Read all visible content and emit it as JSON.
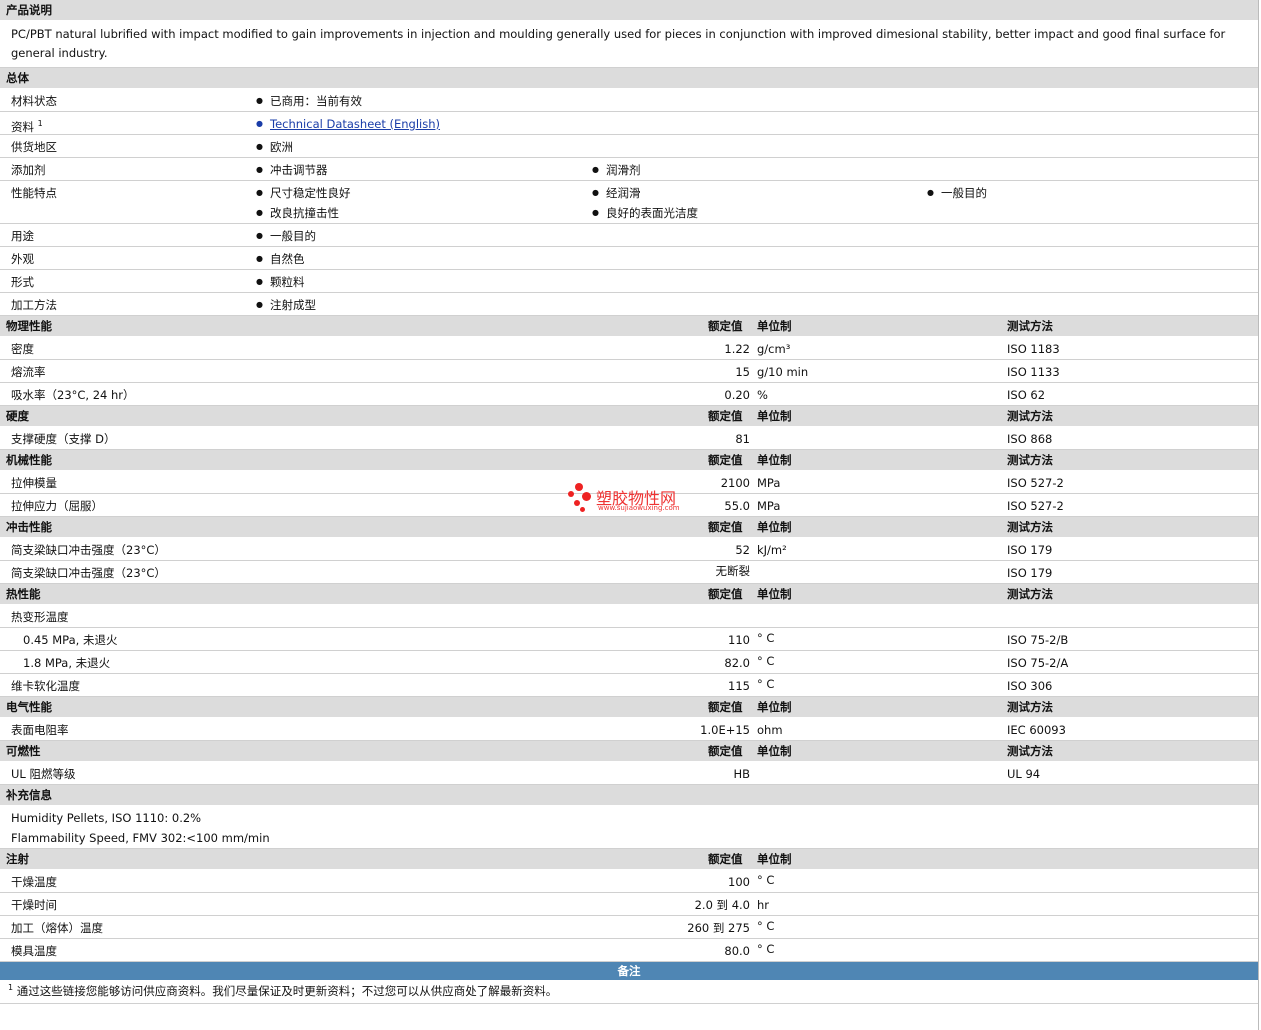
{
  "description": {
    "header": "产品说明",
    "text": "PC/PBT natural lubrified with impact modified to gain improvements in injection and moulding generally used for pieces in conjunction with improved dimesional stability, better impact and good final surface for general industry."
  },
  "general": {
    "header": "总体",
    "status_label": "材料状态",
    "status_value": "已商用：当前有效",
    "docs_label": "资料",
    "docs_sup": "1",
    "docs_link": "Technical Datasheet (English)",
    "region_label": "供货地区",
    "region_value": "欧洲",
    "additives_label": "添加剂",
    "additives": [
      "冲击调节器",
      "润滑剂"
    ],
    "features_label": "性能特点",
    "features": [
      "尺寸稳定性良好",
      "经润滑",
      "一般目的",
      "改良抗撞击性",
      "良好的表面光洁度"
    ],
    "uses_label": "用途",
    "uses_value": "一般目的",
    "appearance_label": "外观",
    "appearance_value": "自然色",
    "form_label": "形式",
    "form_value": "颗粒料",
    "method_label": "加工方法",
    "method_value": "注射成型"
  },
  "cols": {
    "nominal": "额定值",
    "unit": "单位制",
    "test": "测试方法"
  },
  "physical": {
    "header": "物理性能",
    "rows": [
      {
        "label": "密度",
        "value": "1.22",
        "unit": "g/cm³",
        "test": "ISO 1183"
      },
      {
        "label": "熔流率",
        "value": "15",
        "unit": "g/10 min",
        "test": "ISO 1133"
      },
      {
        "label": "吸水率（23°C, 24 hr）",
        "value": "0.20",
        "unit": "%",
        "test": "ISO 62"
      }
    ]
  },
  "hardness": {
    "header": "硬度",
    "rows": [
      {
        "label": "支撑硬度（支撑 D）",
        "value": "81",
        "unit": "",
        "test": "ISO 868"
      }
    ]
  },
  "mechanical": {
    "header": "机械性能",
    "rows": [
      {
        "label": "拉伸模量",
        "value": "2100",
        "unit": "MPa",
        "test": "ISO 527-2"
      },
      {
        "label": "拉伸应力（屈服）",
        "value": "55.0",
        "unit": "MPa",
        "test": "ISO 527-2"
      }
    ]
  },
  "impact": {
    "header": "冲击性能",
    "rows": [
      {
        "label": "简支梁缺口冲击强度（23°C）",
        "value": "52",
        "unit": "kJ/m²",
        "test": "ISO 179"
      },
      {
        "label": "简支梁缺口冲击强度（23°C）",
        "value": "无断裂",
        "unit": "",
        "test": "ISO 179"
      }
    ]
  },
  "thermal": {
    "header": "热性能",
    "hdt_label": "热变形温度",
    "rows": [
      {
        "label": "0.45 MPa, 未退火",
        "value": "110",
        "unit": "° C",
        "test": "ISO 75-2/B"
      },
      {
        "label": "1.8 MPa, 未退火",
        "value": "82.0",
        "unit": "° C",
        "test": "ISO 75-2/A"
      },
      {
        "label": "维卡软化温度",
        "value": "115",
        "unit": "° C",
        "test": "ISO 306"
      }
    ]
  },
  "electrical": {
    "header": "电气性能",
    "rows": [
      {
        "label": "表面电阻率",
        "value": "1.0E+15",
        "unit": "ohm",
        "test": "IEC 60093"
      }
    ]
  },
  "flammability": {
    "header": "可燃性",
    "rows": [
      {
        "label": "UL 阻燃等级",
        "value": "HB",
        "unit": "",
        "test": "UL 94"
      }
    ]
  },
  "supplemental": {
    "header": "补充信息",
    "line1": "Humidity Pellets, ISO 1110: 0.2%",
    "line2": "Flammability Speed, FMV 302:<100 mm/min"
  },
  "injection": {
    "header": "注射",
    "rows": [
      {
        "label": "干燥温度",
        "value": "100",
        "unit": "° C"
      },
      {
        "label": "干燥时间",
        "value": "2.0 到  4.0",
        "unit": "hr"
      },
      {
        "label": "加工（熔体）温度",
        "value": "260 到  275",
        "unit": "° C"
      },
      {
        "label": "模具温度",
        "value": "80.0",
        "unit": "° C"
      }
    ]
  },
  "notes": {
    "header": "备注",
    "sup": "1",
    "text": "通过这些链接您能够访问供应商资料。我们尽量保证及时更新资料；不过您可以从供应商处了解最新资料。"
  },
  "watermark": {
    "name": "塑胶物性网",
    "url": "www.sujiaowuxing.com"
  }
}
